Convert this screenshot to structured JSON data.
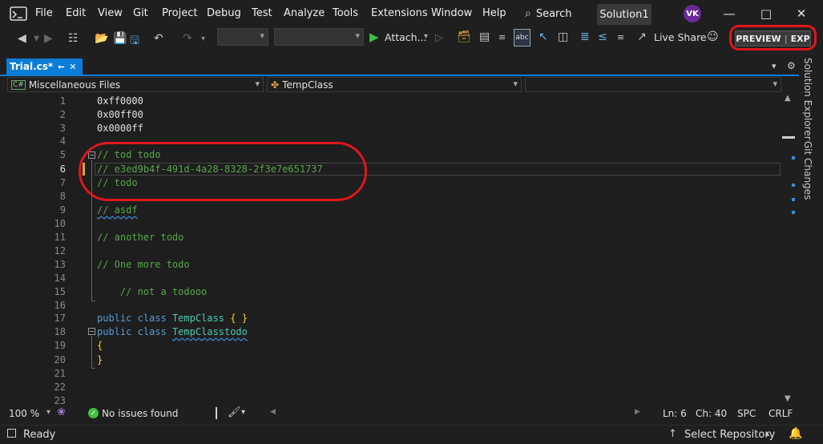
{
  "menu": {
    "items": [
      "File",
      "Edit",
      "View",
      "Git",
      "Project",
      "Debug",
      "Test",
      "Analyze",
      "Tools",
      "Extensions",
      "Window",
      "Help"
    ],
    "search_label": "Search",
    "solution_name": "Solution1",
    "avatar_initials": "VK"
  },
  "toolbar": {
    "attach_label": "Attach...",
    "live_share_label": "Live Share",
    "preview_label": "PREVIEW",
    "exp_label": "EXP"
  },
  "tab": {
    "filename": "Trial.cs*"
  },
  "navbar": {
    "project_label": "Miscellaneous Files",
    "class_label": "TempClass"
  },
  "editor": {
    "lines": [
      {
        "n": "1",
        "text": "0xff0000",
        "kind": "num"
      },
      {
        "n": "2",
        "text": "0x00ff00",
        "kind": "num"
      },
      {
        "n": "3",
        "text": "0x0000ff",
        "kind": "num"
      },
      {
        "n": "4",
        "text": "",
        "kind": "blank"
      },
      {
        "n": "5",
        "text": "// tod todo",
        "kind": "cmt"
      },
      {
        "n": "6",
        "text": "// e3ed9b4f-491d-4a28-8328-2f3e7e651737",
        "kind": "cmt"
      },
      {
        "n": "7",
        "text": "// todo",
        "kind": "cmt"
      },
      {
        "n": "8",
        "text": "",
        "kind": "blank"
      },
      {
        "n": "9",
        "text": "// asdf",
        "kind": "cmt"
      },
      {
        "n": "10",
        "text": "",
        "kind": "blank"
      },
      {
        "n": "11",
        "text": "// another todo",
        "kind": "cmt"
      },
      {
        "n": "12",
        "text": "",
        "kind": "blank"
      },
      {
        "n": "13",
        "text": "// One more todo",
        "kind": "cmt"
      },
      {
        "n": "14",
        "text": "",
        "kind": "blank"
      },
      {
        "n": "15",
        "text": "    // not a todooo",
        "kind": "cmt"
      },
      {
        "n": "16",
        "text": "",
        "kind": "blank"
      },
      {
        "n": "17",
        "text": "public class TempClass { }",
        "kind": "class1"
      },
      {
        "n": "18",
        "text": "public class TempClasstodo",
        "kind": "class2"
      },
      {
        "n": "19",
        "text": "{",
        "kind": "brace"
      },
      {
        "n": "20",
        "text": "}",
        "kind": "brace"
      },
      {
        "n": "21",
        "text": "",
        "kind": "blank"
      },
      {
        "n": "22",
        "text": "",
        "kind": "blank"
      },
      {
        "n": "23",
        "text": "",
        "kind": "blank"
      }
    ],
    "current_line": "6"
  },
  "sidepanel": {
    "solution_explorer": "Solution Explorer",
    "git_changes": "Git Changes"
  },
  "editorbar": {
    "zoom": "100 %",
    "issues": "No issues found",
    "line": "Ln: 6",
    "col": "Ch: 40",
    "whitespace": "SPC",
    "line_ending": "CRLF"
  },
  "status": {
    "ready": "Ready",
    "select_repo": "Select Repository"
  },
  "colors": {
    "accent": "#0c7dd6",
    "comment": "#57a64a",
    "keyword": "#569cd6",
    "class": "#4ec9b0",
    "annotation_red": "#e0161b"
  }
}
